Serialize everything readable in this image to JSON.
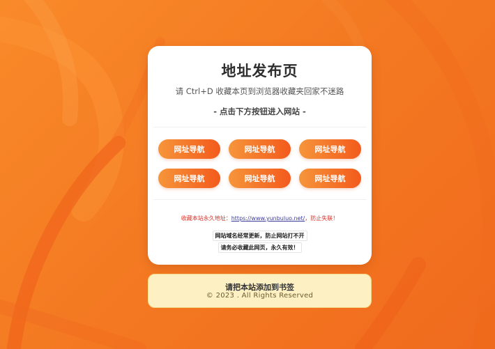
{
  "colors": {
    "background": "#f47a22",
    "button_gradient_start": "#f6953a",
    "button_gradient_end": "#f35a1c",
    "footer_background": "#fdf1c4",
    "warning_text": "#d6322a"
  },
  "card": {
    "title": "地址发布页",
    "subtitle": "请 Ctrl+D 收藏本页到浏览器收藏夹回家不迷路",
    "cta": "- 点击下方按钮进入网站 -"
  },
  "nav_buttons": [
    {
      "label": "网址导航"
    },
    {
      "label": "网址导航"
    },
    {
      "label": "网址导航"
    },
    {
      "label": "网址导航"
    },
    {
      "label": "网址导航"
    },
    {
      "label": "网址导航"
    }
  ],
  "permanent": {
    "prefix": "收藏本站永久地址：",
    "url": "https://www.yunbuluo.net/",
    "suffix": "，防止失联！"
  },
  "notes": {
    "line1": "网站域名经常更新，防止网站打不开",
    "line2": "请务必收藏此网页，永久有效！"
  },
  "footer": {
    "title": "请把本站添加到书签",
    "copyright": "© 2023 . All Rights Reserved"
  }
}
